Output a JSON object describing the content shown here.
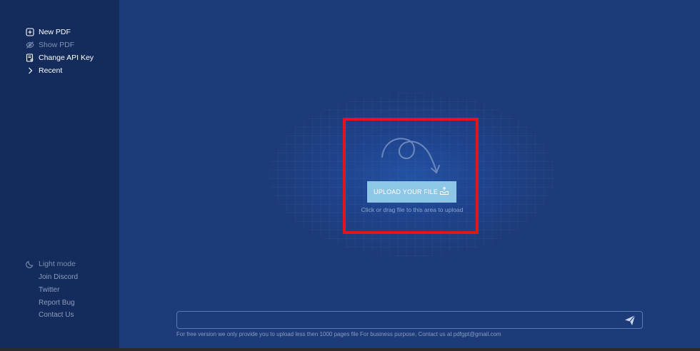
{
  "sidebar": {
    "nav": [
      {
        "label": "New PDF",
        "icon": "plus-square-icon"
      },
      {
        "label": "Show PDF",
        "icon": "eye-off-icon"
      },
      {
        "label": "Change API Key",
        "icon": "key-doc-icon"
      },
      {
        "label": "Recent",
        "icon": "chevron-right-icon"
      }
    ],
    "footer": {
      "light_mode": "Light mode",
      "join_discord": "Join Discord",
      "twitter": "Twitter",
      "report_bug": "Report Bug",
      "contact_us": "Contact Us"
    }
  },
  "upload": {
    "button_label": "UPLOAD YOUR FILE",
    "hint": "Click or drag file to this area to upload"
  },
  "chat": {
    "input_value": "",
    "input_placeholder": "",
    "disclaimer": "For free version we only provide you to upload less then 1000 pages file For business purpose, Contact us at pdfgpt@gmail.com"
  },
  "colors": {
    "sidebar_bg": "#132c5c",
    "main_bg": "#1d3b78",
    "upload_button": "#8ec6e6",
    "highlight": "#e3141b"
  }
}
